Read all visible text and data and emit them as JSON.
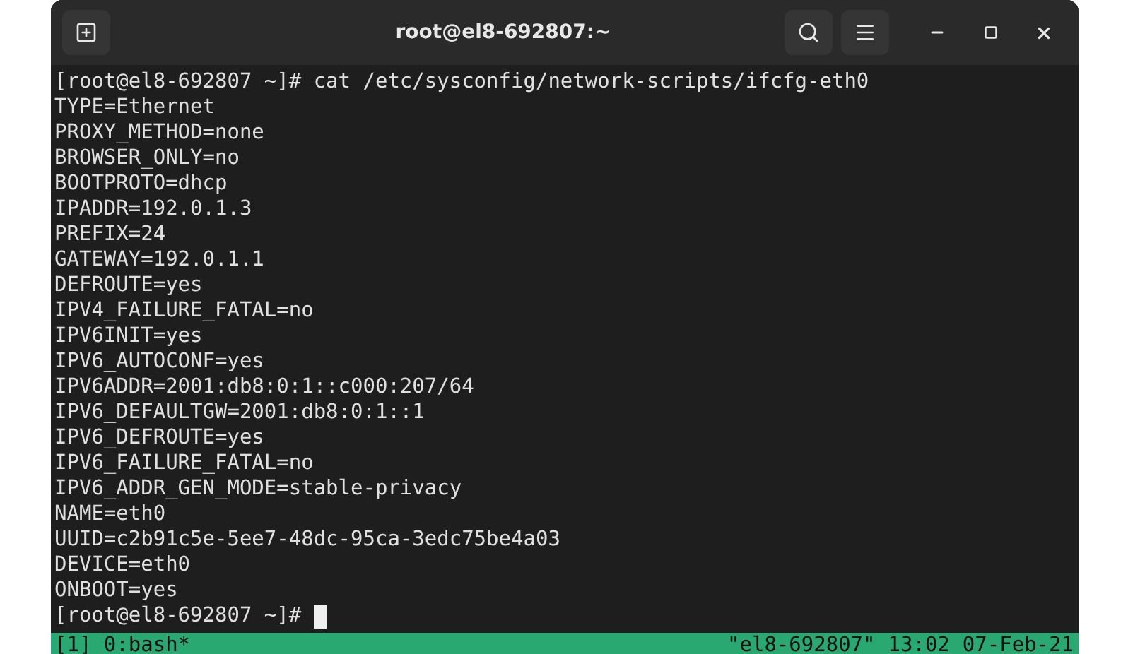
{
  "window": {
    "title": "root@el8-692807:~"
  },
  "terminal": {
    "lines": [
      "[root@el8-692807 ~]# cat /etc/sysconfig/network-scripts/ifcfg-eth0",
      "TYPE=Ethernet",
      "PROXY_METHOD=none",
      "BROWSER_ONLY=no",
      "BOOTPROTO=dhcp",
      "IPADDR=192.0.1.3",
      "PREFIX=24",
      "GATEWAY=192.0.1.1",
      "DEFROUTE=yes",
      "IPV4_FAILURE_FATAL=no",
      "IPV6INIT=yes",
      "IPV6_AUTOCONF=yes",
      "IPV6ADDR=2001:db8:0:1::c000:207/64",
      "IPV6_DEFAULTGW=2001:db8:0:1::1",
      "IPV6_DEFROUTE=yes",
      "IPV6_FAILURE_FATAL=no",
      "IPV6_ADDR_GEN_MODE=stable-privacy",
      "NAME=eth0",
      "UUID=c2b91c5e-5ee7-48dc-95ca-3edc75be4a03",
      "DEVICE=eth0",
      "ONBOOT=yes"
    ],
    "prompt": "[root@el8-692807 ~]#"
  },
  "status_bar": {
    "window_list": "[1] 0:bash*",
    "host": "\"el8-692807\"",
    "time": "13:02",
    "date": "07-Feb-21"
  }
}
